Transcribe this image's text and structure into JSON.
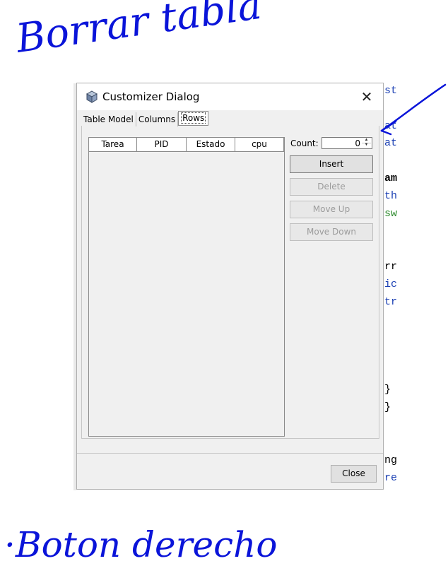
{
  "annotations": {
    "top_note": "Borrar tabla",
    "bottom_note": "·Boton derecho"
  },
  "editor_fragments": [
    {
      "text": "st",
      "color": "#1a3fb3"
    },
    {
      "text": "at",
      "color": "#1a3fb3"
    },
    {
      "text": "at",
      "color": "#1a3fb3"
    },
    {
      "text": "am",
      "color": "#000000"
    },
    {
      "text": "th",
      "color": "#1a3fb3"
    },
    {
      "text": "sw",
      "color": "#2e8b2e"
    },
    {
      "text": "rr",
      "color": "#000000"
    },
    {
      "text": "ic",
      "color": "#1a3fb3"
    },
    {
      "text": "tr",
      "color": "#1a3fb3"
    },
    {
      "text": "}",
      "color": "#000000"
    },
    {
      "text": "}",
      "color": "#000000"
    },
    {
      "text": "ng",
      "color": "#000000"
    },
    {
      "text": "re",
      "color": "#1a3fb3"
    }
  ],
  "dialog": {
    "title": "Customizer Dialog",
    "close_glyph": "✕",
    "tabs": [
      {
        "label": "Table Model",
        "active": false
      },
      {
        "label": "Columns",
        "active": false
      },
      {
        "label": "Rows",
        "active": true
      }
    ],
    "table": {
      "columns": [
        "Tarea",
        "PID",
        "Estado",
        "cpu"
      ],
      "rows": []
    },
    "count": {
      "label": "Count:",
      "value": "0"
    },
    "buttons": {
      "insert": "Insert",
      "delete": "Delete",
      "move_up": "Move Up",
      "move_down": "Move Down",
      "close": "Close"
    }
  },
  "colors": {
    "ink": "#0a14d9",
    "dialog_bg": "#f0f0f0"
  },
  "icons": [
    "cube-icon",
    "close-icon",
    "spinner-up-icon",
    "spinner-down-icon",
    "arrow-annotation-icon"
  ]
}
